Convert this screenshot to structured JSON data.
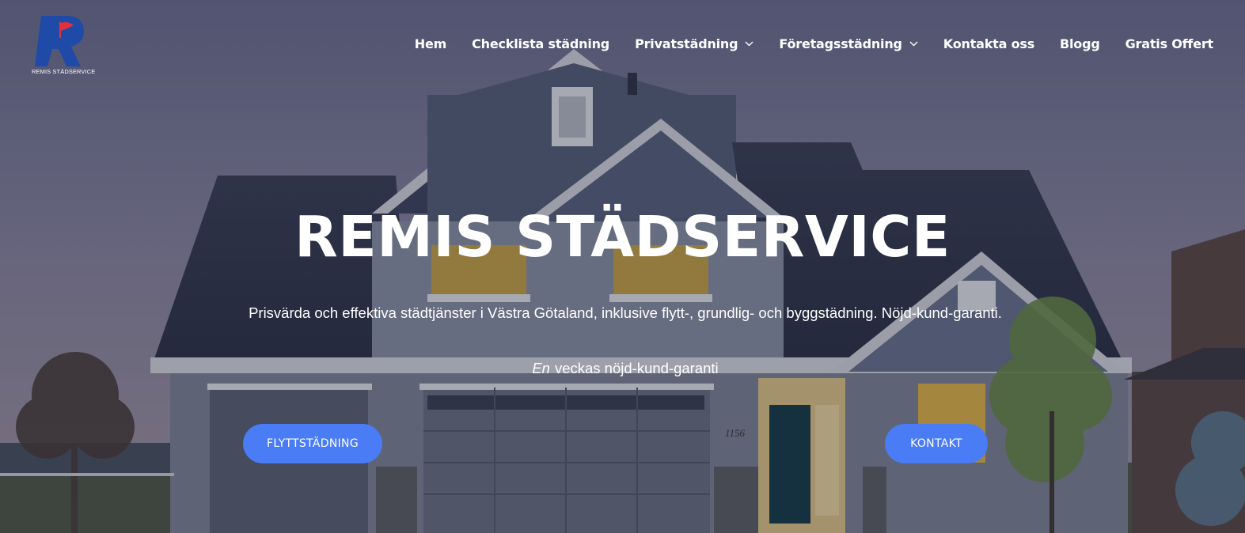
{
  "logo": {
    "text": "REMIS STÄDSERVICE"
  },
  "nav": {
    "items": [
      {
        "label": "Hem",
        "has_dropdown": false
      },
      {
        "label": "Checklista städning",
        "has_dropdown": false
      },
      {
        "label": "Privatstädning",
        "has_dropdown": true
      },
      {
        "label": "Företagsstädning",
        "has_dropdown": true
      },
      {
        "label": "Kontakta oss",
        "has_dropdown": false
      },
      {
        "label": "Blogg",
        "has_dropdown": false
      },
      {
        "label": "Gratis Offert",
        "has_dropdown": false
      }
    ]
  },
  "hero": {
    "title": "REMIS STÄDSERVICE",
    "subtitle": "Prisvärda och effektiva städtjänster i Västra Götaland, inklusive flytt-, grundlig- och byggstädning. Nöjd-kund-garanti.",
    "guarantee_em": "En",
    "guarantee_rest": "veckas nöjd-kund-garanti",
    "buttons": {
      "primary": "FLYTTSTÄDNING",
      "secondary": "KONTAKT"
    },
    "house_number": "1156"
  },
  "colors": {
    "button": "#4a7cf5",
    "logo_blue": "#1f4aa8",
    "logo_red": "#e0313b",
    "overlay": "rgba(20,22,40,0.30)"
  }
}
